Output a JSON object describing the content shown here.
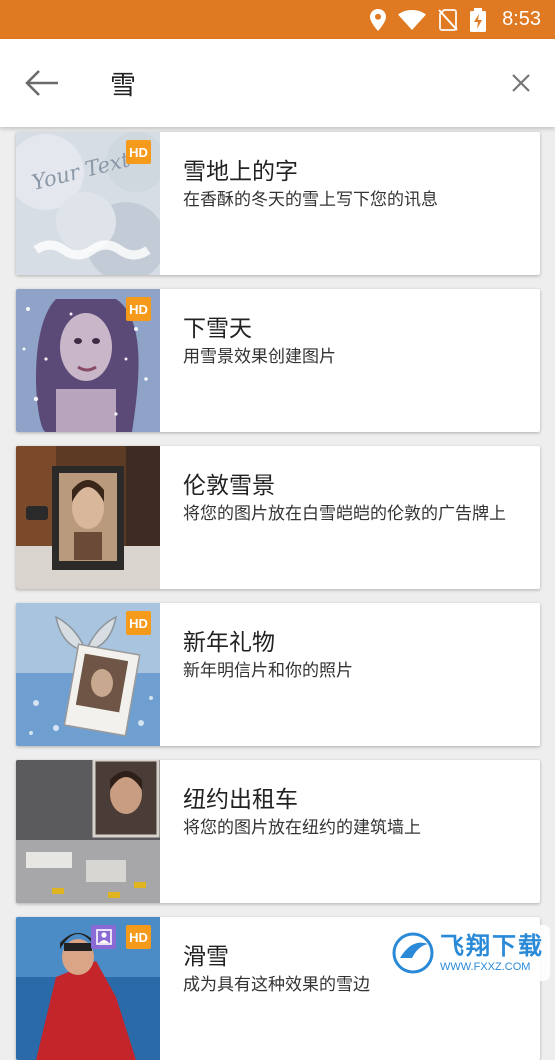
{
  "status_bar": {
    "time": "8:53"
  },
  "search": {
    "query": "雪"
  },
  "results": [
    {
      "title": "雪地上的字",
      "description": "在香酥的冬天的雪上写下您的讯息",
      "badge": "HD"
    },
    {
      "title": "下雪天",
      "description": "用雪景效果创建图片",
      "badge": "HD"
    },
    {
      "title": "伦敦雪景",
      "description": "将您的图片放在白雪皑皑的伦敦的广告牌上",
      "badge": ""
    },
    {
      "title": "新年礼物",
      "description": "新年明信片和你的照片",
      "badge": "HD"
    },
    {
      "title": "纽约出租车",
      "description": "将您的图片放在纽约的建筑墙上",
      "badge": ""
    },
    {
      "title": "滑雪",
      "description": "成为具有这种效果的雪边",
      "badge": "HD"
    }
  ],
  "thumb1_text": "Your Text",
  "watermark": {
    "name": "飞翔下载",
    "url": "WWW.FXXZ.COM"
  }
}
